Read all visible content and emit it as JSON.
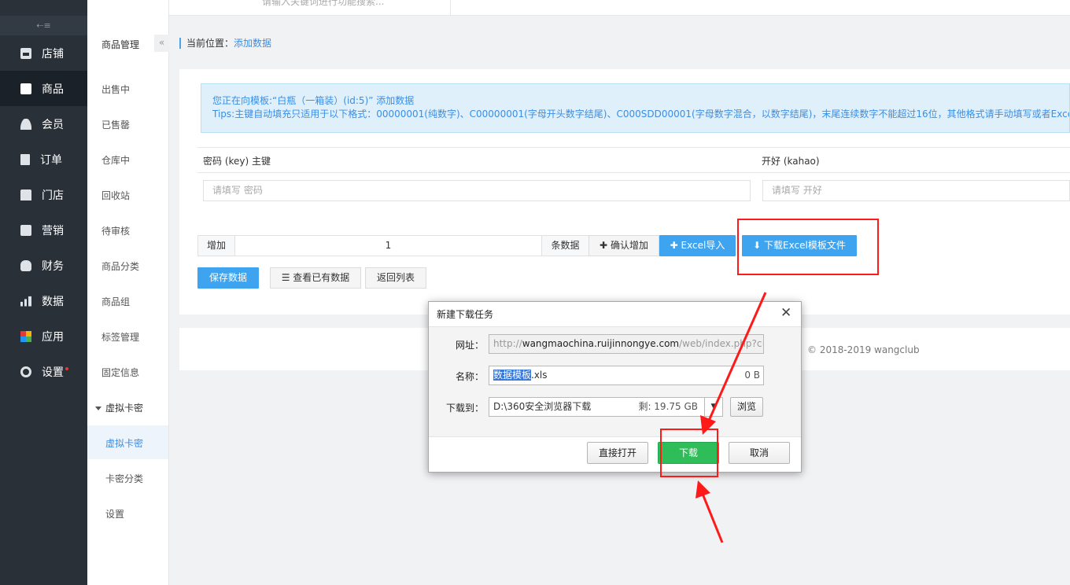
{
  "sidebar": {
    "collapse_icon": "collapse-icon",
    "items": [
      {
        "label": "店铺",
        "icon": "store-icon"
      },
      {
        "label": "商品",
        "icon": "goods-icon"
      },
      {
        "label": "会员",
        "icon": "user-icon"
      },
      {
        "label": "订单",
        "icon": "order-icon"
      },
      {
        "label": "门店",
        "icon": "shop-icon"
      },
      {
        "label": "营销",
        "icon": "gift-icon"
      },
      {
        "label": "财务",
        "icon": "money-icon"
      },
      {
        "label": "数据",
        "icon": "data-icon"
      },
      {
        "label": "应用",
        "icon": "app-icon"
      },
      {
        "label": "设置",
        "icon": "gear-icon"
      }
    ],
    "active": "商品"
  },
  "submenu": {
    "title": "商品管理",
    "collapse_label": "«",
    "items": [
      "出售中",
      "已售罄",
      "仓库中",
      "回收站",
      "待审核",
      "商品分类",
      "商品组",
      "标签管理",
      "固定信息"
    ],
    "group": "虚拟卡密",
    "group_items": [
      "虚拟卡密",
      "卡密分类",
      "设置"
    ],
    "active": "虚拟卡密"
  },
  "topbar": {
    "search_placeholder": "请输入关键词进行功能搜索..."
  },
  "breadcrumb": {
    "prefix": "当前位置：",
    "current": "添加数据"
  },
  "tips": {
    "line1": "您正在向模板:“白瓶（一箱装）(id:5)” 添加数据",
    "line2": "Tips:主键自动填充只适用于以下格式：00000001(纯数字)、C00000001(字母开头数字结尾)、C000SDD00001(字母数字混合，以数字结尾)，末尾连续数字不能超过16位，其他格式请手动填写或者Excel导入"
  },
  "table": {
    "col1_header": "密码 (key) 主键",
    "col2_header": "开好 (kahao)",
    "col1_placeholder": "请填写 密码",
    "col2_placeholder": "请填写 开好"
  },
  "add_row": {
    "label": "增加",
    "count": "1",
    "unit": "条数据",
    "confirm": "确认增加",
    "excel_import": "Excel导入",
    "download_template": "下载Excel模板文件"
  },
  "actions": {
    "save": "保存数据",
    "view": "查看已有数据",
    "back": "返回列表"
  },
  "footer": {
    "copyright": "© 2018-2019 wangclub"
  },
  "dialog": {
    "title": "新建下载任务",
    "url_label": "网址：",
    "url_prefix": "http://",
    "url_domain": "wangmaochina.ruijinnongye.com",
    "url_path": "/web/index.php?c=s",
    "name_label": "名称：",
    "name_selected": "数据模板",
    "name_ext": ".xls",
    "name_size": "0 B",
    "save_label": "下载到：",
    "save_path": "D:\\360安全浏览器下载",
    "free_space": "剩: 19.75 GB",
    "browse": "浏览",
    "open_direct": "直接打开",
    "download": "下载",
    "cancel": "取消"
  },
  "colors": {
    "sidebar_bg": "#293038",
    "accent_blue": "#3fa4ef",
    "download_green": "#2fbd5a",
    "annotation_red": "#ff1a1a"
  }
}
